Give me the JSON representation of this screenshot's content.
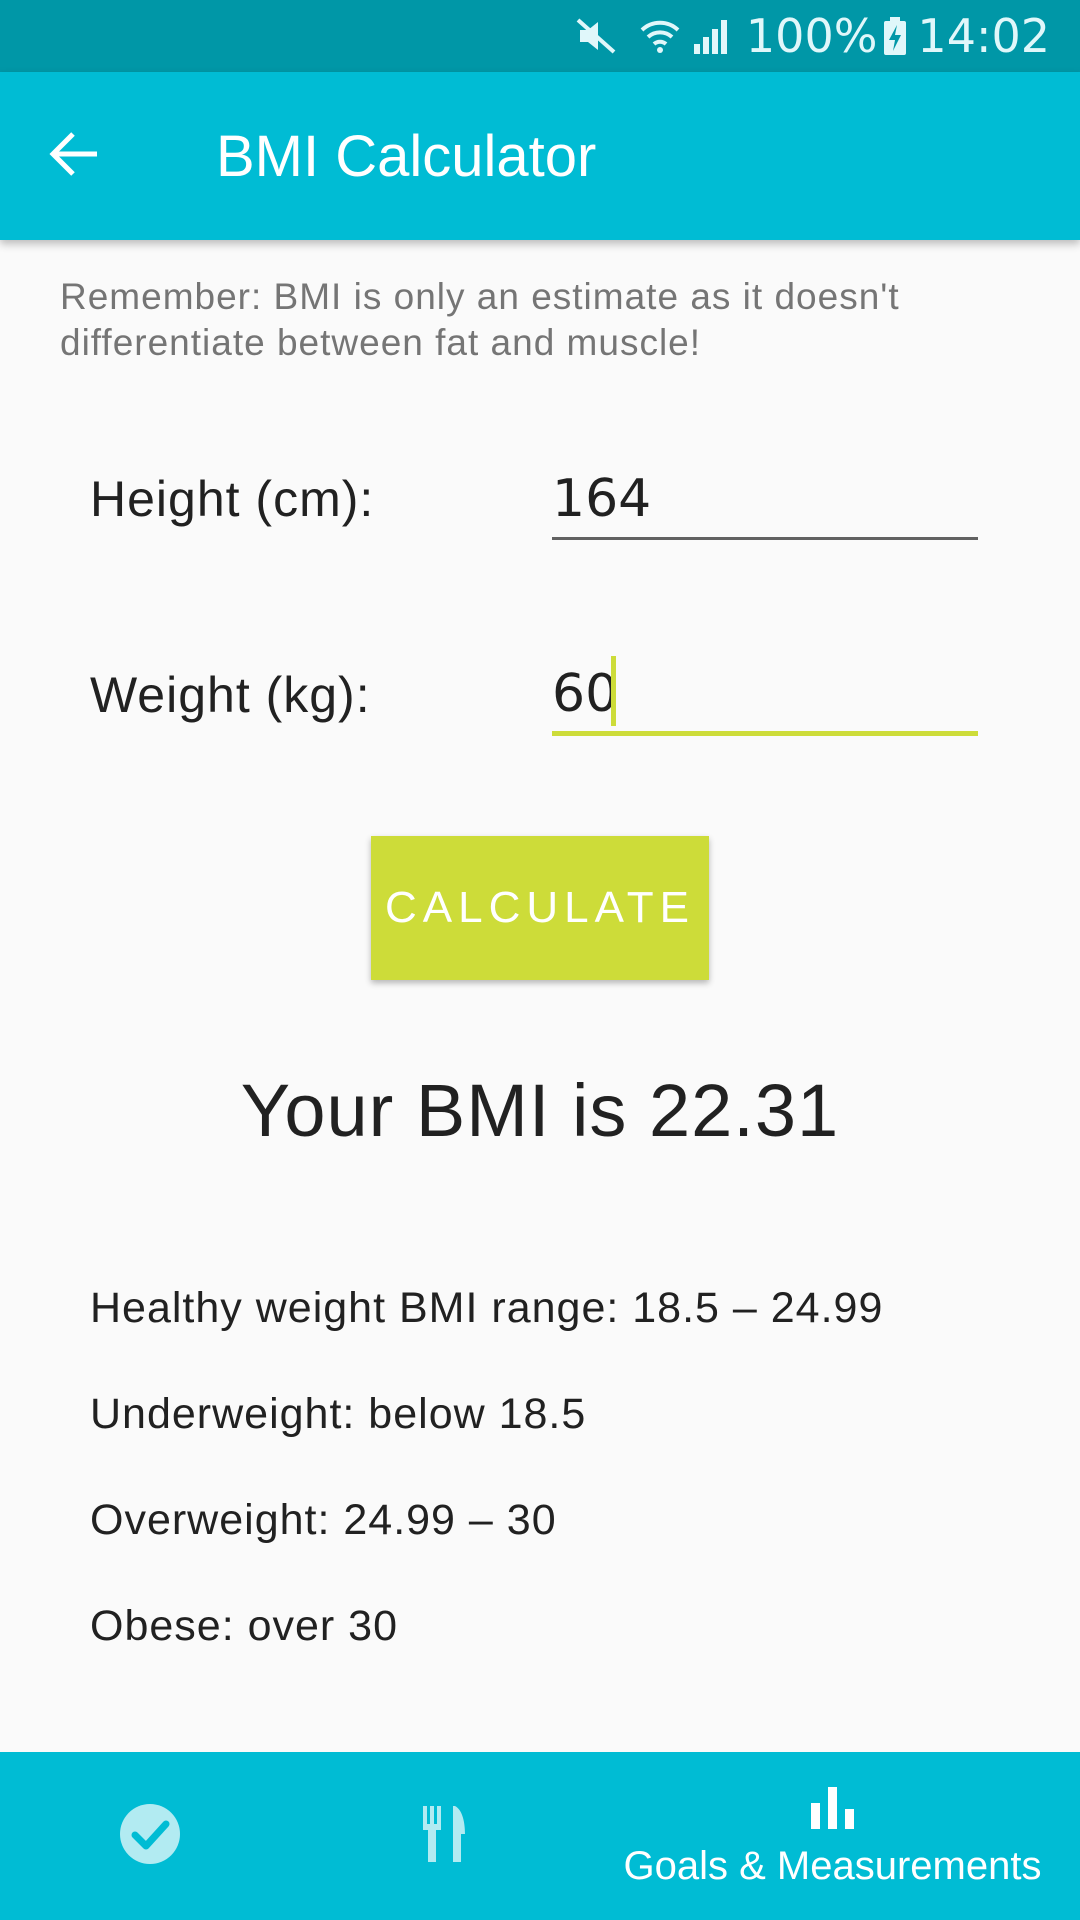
{
  "status_bar": {
    "battery": "100%",
    "time": "14:02",
    "icons": [
      "mute-icon",
      "wifi-icon",
      "signal-icon",
      "battery-charging-icon"
    ]
  },
  "app_bar": {
    "title": "BMI Calculator",
    "back_icon": "arrow-back-icon"
  },
  "note": "Remember: BMI is only an estimate as it doesn't differentiate between fat and muscle!",
  "form": {
    "height_label": "Height (cm):",
    "height_value": "164",
    "weight_label": "Weight (kg):",
    "weight_value": "60",
    "calculate_label": "CALCULATE"
  },
  "result": "Your BMI is 22.31",
  "ranges": [
    "Healthy weight BMI range: 18.5 – 24.99",
    "Underweight: below 18.5",
    "Overweight: 24.99 – 30",
    "Obese: over 30"
  ],
  "bottom_nav": {
    "items": [
      {
        "icon": "check-circle-icon",
        "label": ""
      },
      {
        "icon": "fork-knife-icon",
        "label": ""
      },
      {
        "icon": "bar-chart-icon",
        "label": "Goals & Measurements"
      }
    ]
  },
  "colors": {
    "status_bar": "#0097a7",
    "app_bar": "#00bcd4",
    "accent": "#cddc39",
    "background": "#fafafa"
  }
}
